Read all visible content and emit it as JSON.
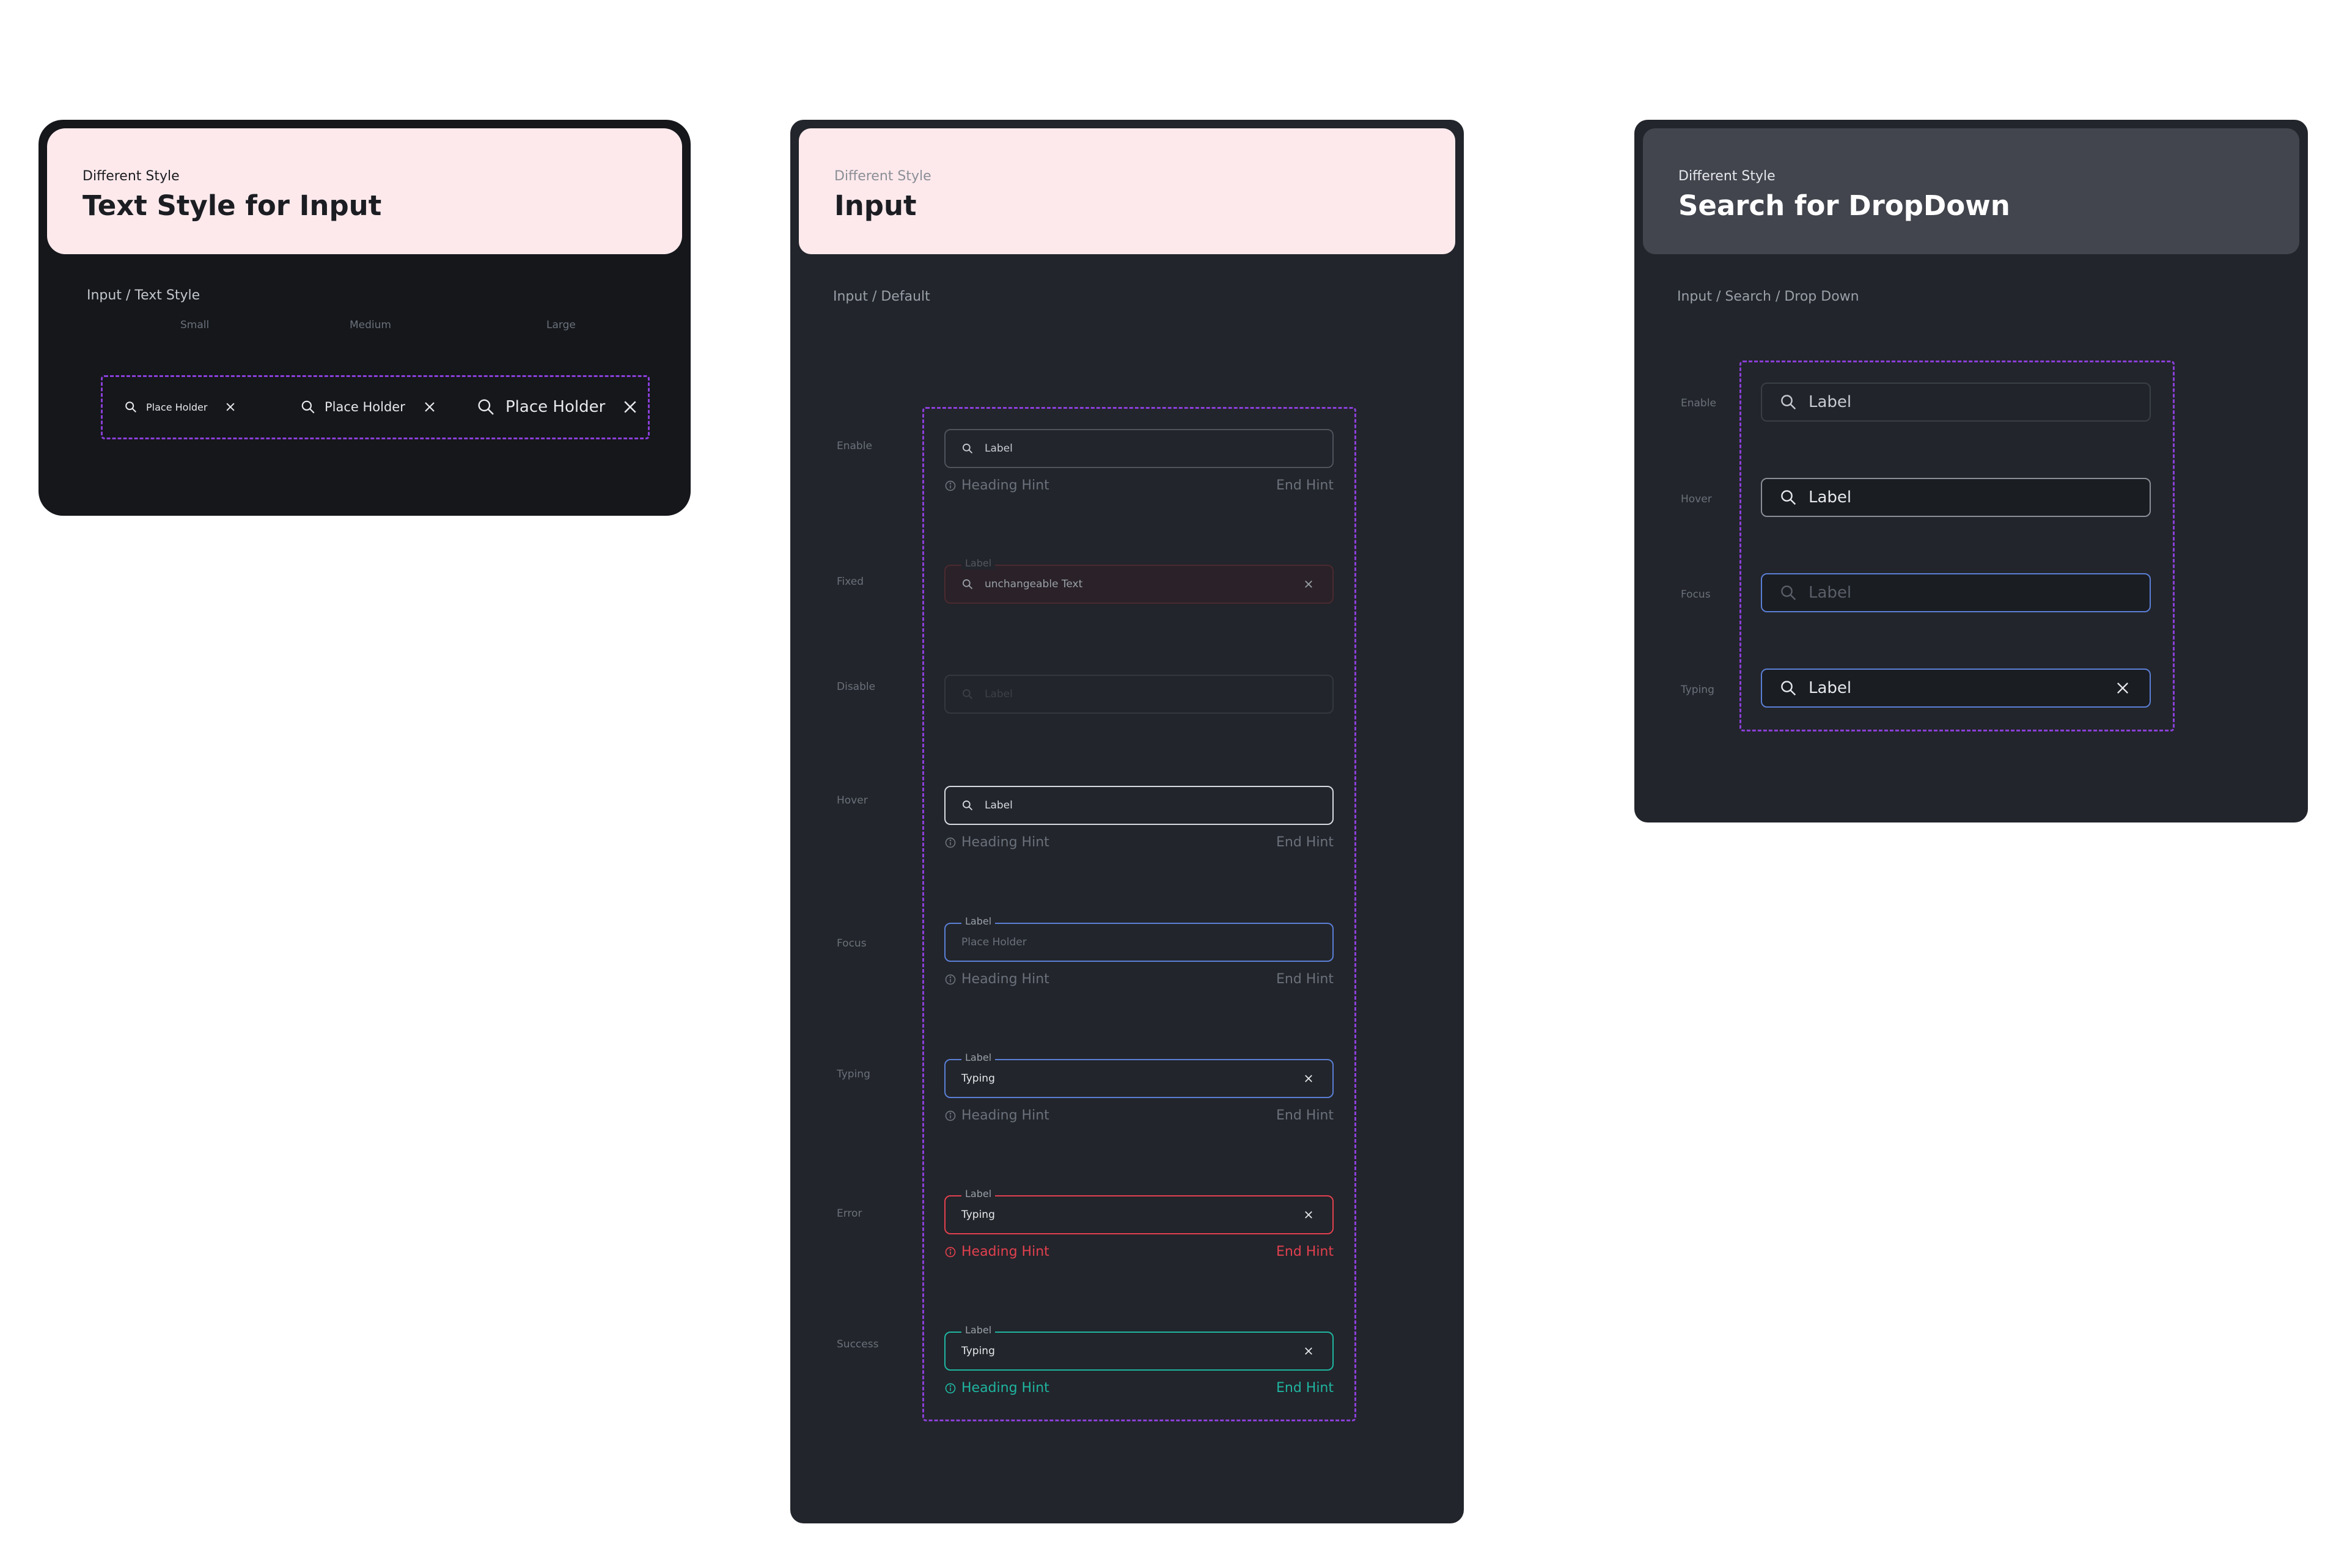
{
  "colors": {
    "panel_dark": "#15171b",
    "panel_mid": "#22252b",
    "header_pink": "#fde9ec",
    "header_gray": "#42454d",
    "dashed": "#8b3fd9",
    "border_default": "#4e535c",
    "border_hover": "#d7dbe0",
    "border_focus": "#5b7fd6",
    "border_fixed": "#5e2a31",
    "error": "#e2404f",
    "success": "#1fb5a1"
  },
  "text_style_panel": {
    "header": {
      "subtitle": "Different Style",
      "title": "Text Style for Input"
    },
    "section_label": "Input / Text Style",
    "columns": [
      "Small",
      "Medium",
      "Large"
    ],
    "samples": [
      {
        "text": "Place Holder",
        "icon": "search-icon",
        "clear_icon": "close-icon"
      },
      {
        "text": "Place Holder",
        "icon": "search-icon",
        "clear_icon": "close-icon"
      },
      {
        "text": "Place Holder",
        "icon": "search-icon",
        "clear_icon": "close-icon"
      }
    ]
  },
  "input_panel": {
    "header": {
      "subtitle": "Different Style",
      "title": "Input"
    },
    "section_label": "Input / Default",
    "states": [
      {
        "state": "Enable",
        "text": "Label",
        "hint_start": "Heading Hint",
        "hint_end": "End Hint"
      },
      {
        "state": "Fixed",
        "float_label": "Label",
        "text": "unchangeable Text"
      },
      {
        "state": "Disable",
        "text": "Label"
      },
      {
        "state": "Hover",
        "text": "Label",
        "hint_start": "Heading Hint",
        "hint_end": "End Hint"
      },
      {
        "state": "Focus",
        "float_label": "Label",
        "text": "Place Holder",
        "hint_start": "Heading Hint",
        "hint_end": "End Hint"
      },
      {
        "state": "Typing",
        "float_label": "Label",
        "text": "Typing",
        "hint_start": "Heading Hint",
        "hint_end": "End Hint"
      },
      {
        "state": "Error",
        "float_label": "Label",
        "text": "Typing",
        "hint_start": "Heading Hint",
        "hint_end": "End Hint"
      },
      {
        "state": "Success",
        "float_label": "Label",
        "text": "Typing",
        "hint_start": "Heading Hint",
        "hint_end": "End Hint"
      }
    ]
  },
  "dropdown_panel": {
    "header": {
      "subtitle": "Different Style",
      "title": "Search for DropDown"
    },
    "section_label": "Input / Search / Drop Down",
    "states": [
      {
        "state": "Enable",
        "text": "Label"
      },
      {
        "state": "Hover",
        "text": "Label"
      },
      {
        "state": "Focus",
        "text": "Label"
      },
      {
        "state": "Typing",
        "text": "Label"
      }
    ]
  }
}
